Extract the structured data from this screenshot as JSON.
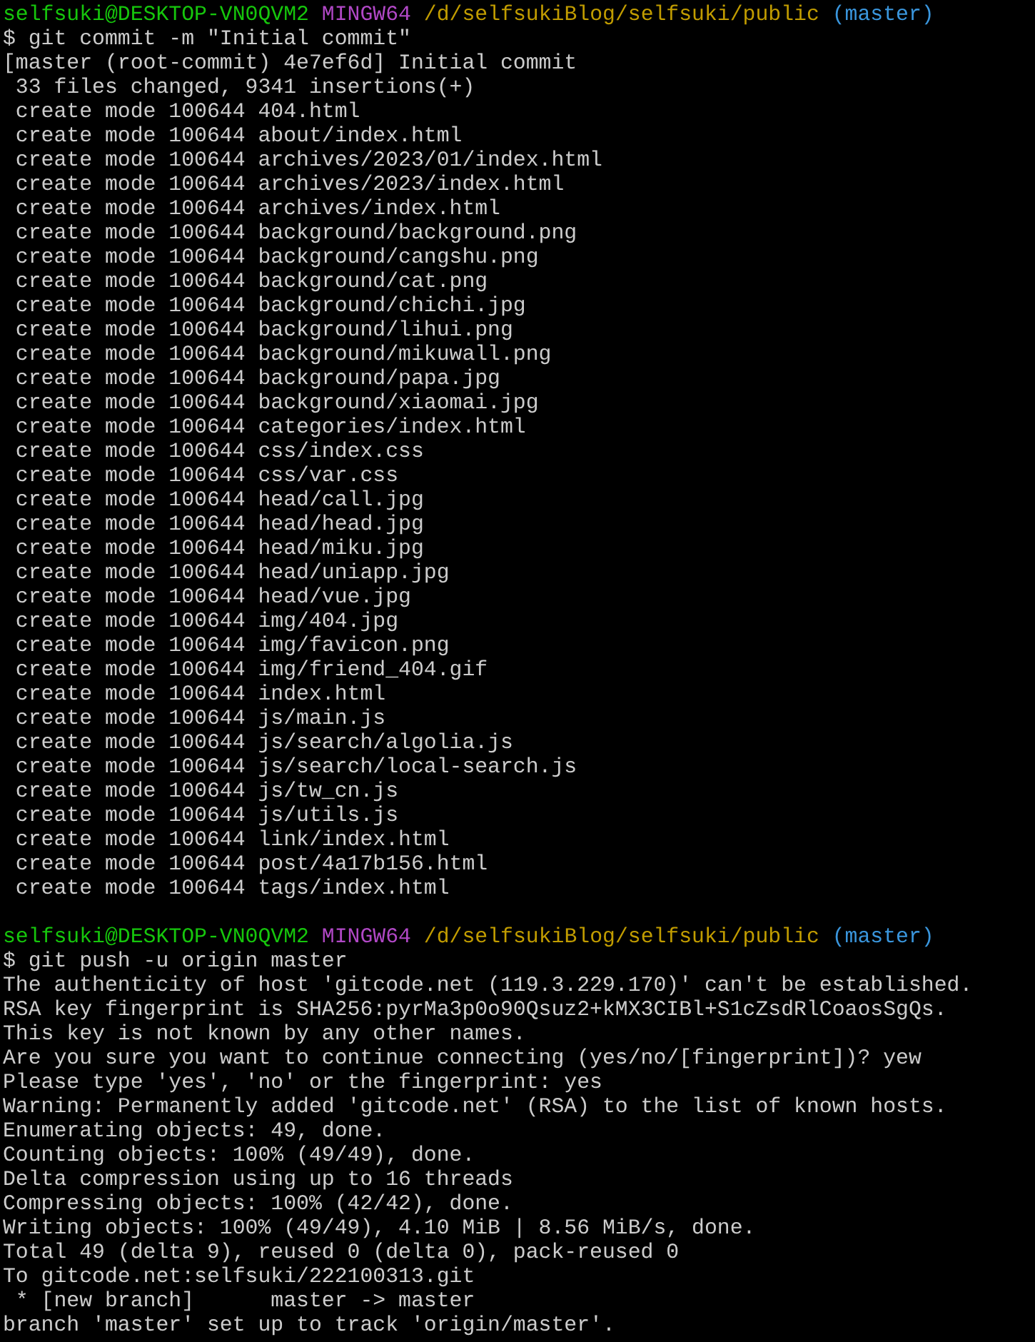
{
  "terminal": {
    "lines": [
      {
        "kind": "prompt",
        "user_host": "selfsuki@DESKTOP-VN0QVM2",
        "shell": "MINGW64",
        "path": "/d/selfsukiBlog/selfsuki/public",
        "branch": "(master)"
      },
      {
        "kind": "output",
        "text": "$ git commit -m \"Initial commit\""
      },
      {
        "kind": "output",
        "text": "[master (root-commit) 4e7ef6d] Initial commit"
      },
      {
        "kind": "output",
        "text": " 33 files changed, 9341 insertions(+)"
      },
      {
        "kind": "output",
        "text": " create mode 100644 404.html"
      },
      {
        "kind": "output",
        "text": " create mode 100644 about/index.html"
      },
      {
        "kind": "output",
        "text": " create mode 100644 archives/2023/01/index.html"
      },
      {
        "kind": "output",
        "text": " create mode 100644 archives/2023/index.html"
      },
      {
        "kind": "output",
        "text": " create mode 100644 archives/index.html"
      },
      {
        "kind": "output",
        "text": " create mode 100644 background/background.png"
      },
      {
        "kind": "output",
        "text": " create mode 100644 background/cangshu.png"
      },
      {
        "kind": "output",
        "text": " create mode 100644 background/cat.png"
      },
      {
        "kind": "output",
        "text": " create mode 100644 background/chichi.jpg"
      },
      {
        "kind": "output",
        "text": " create mode 100644 background/lihui.png"
      },
      {
        "kind": "output",
        "text": " create mode 100644 background/mikuwall.png"
      },
      {
        "kind": "output",
        "text": " create mode 100644 background/papa.jpg"
      },
      {
        "kind": "output",
        "text": " create mode 100644 background/xiaomai.jpg"
      },
      {
        "kind": "output",
        "text": " create mode 100644 categories/index.html"
      },
      {
        "kind": "output",
        "text": " create mode 100644 css/index.css"
      },
      {
        "kind": "output",
        "text": " create mode 100644 css/var.css"
      },
      {
        "kind": "output",
        "text": " create mode 100644 head/call.jpg"
      },
      {
        "kind": "output",
        "text": " create mode 100644 head/head.jpg"
      },
      {
        "kind": "output",
        "text": " create mode 100644 head/miku.jpg"
      },
      {
        "kind": "output",
        "text": " create mode 100644 head/uniapp.jpg"
      },
      {
        "kind": "output",
        "text": " create mode 100644 head/vue.jpg"
      },
      {
        "kind": "output",
        "text": " create mode 100644 img/404.jpg"
      },
      {
        "kind": "output",
        "text": " create mode 100644 img/favicon.png"
      },
      {
        "kind": "output",
        "text": " create mode 100644 img/friend_404.gif"
      },
      {
        "kind": "output",
        "text": " create mode 100644 index.html"
      },
      {
        "kind": "output",
        "text": " create mode 100644 js/main.js"
      },
      {
        "kind": "output",
        "text": " create mode 100644 js/search/algolia.js"
      },
      {
        "kind": "output",
        "text": " create mode 100644 js/search/local-search.js"
      },
      {
        "kind": "output",
        "text": " create mode 100644 js/tw_cn.js"
      },
      {
        "kind": "output",
        "text": " create mode 100644 js/utils.js"
      },
      {
        "kind": "output",
        "text": " create mode 100644 link/index.html"
      },
      {
        "kind": "output",
        "text": " create mode 100644 post/4a17b156.html"
      },
      {
        "kind": "output",
        "text": " create mode 100644 tags/index.html"
      },
      {
        "kind": "blank"
      },
      {
        "kind": "prompt",
        "user_host": "selfsuki@DESKTOP-VN0QVM2",
        "shell": "MINGW64",
        "path": "/d/selfsukiBlog/selfsuki/public",
        "branch": "(master)"
      },
      {
        "kind": "output",
        "text": "$ git push -u origin master"
      },
      {
        "kind": "output",
        "text": "The authenticity of host 'gitcode.net (119.3.229.170)' can't be established."
      },
      {
        "kind": "output",
        "text": "RSA key fingerprint is SHA256:pyrMa3p0o90Qsuz2+kMX3CIBl+S1cZsdRlCoaosSgQs."
      },
      {
        "kind": "output",
        "text": "This key is not known by any other names."
      },
      {
        "kind": "output",
        "text": "Are you sure you want to continue connecting (yes/no/[fingerprint])? yew"
      },
      {
        "kind": "output",
        "text": "Please type 'yes', 'no' or the fingerprint: yes"
      },
      {
        "kind": "output",
        "text": "Warning: Permanently added 'gitcode.net' (RSA) to the list of known hosts."
      },
      {
        "kind": "output",
        "text": "Enumerating objects: 49, done."
      },
      {
        "kind": "output",
        "text": "Counting objects: 100% (49/49), done."
      },
      {
        "kind": "output",
        "text": "Delta compression using up to 16 threads"
      },
      {
        "kind": "output",
        "text": "Compressing objects: 100% (42/42), done."
      },
      {
        "kind": "output",
        "text": "Writing objects: 100% (49/49), 4.10 MiB | 8.56 MiB/s, done."
      },
      {
        "kind": "output",
        "text": "Total 49 (delta 9), reused 0 (delta 0), pack-reused 0"
      },
      {
        "kind": "output",
        "text": "To gitcode.net:selfsuki/222100313.git"
      },
      {
        "kind": "output",
        "text": " * [new branch]      master -> master"
      },
      {
        "kind": "output",
        "text": "branch 'master' set up to track 'origin/master'."
      }
    ]
  }
}
